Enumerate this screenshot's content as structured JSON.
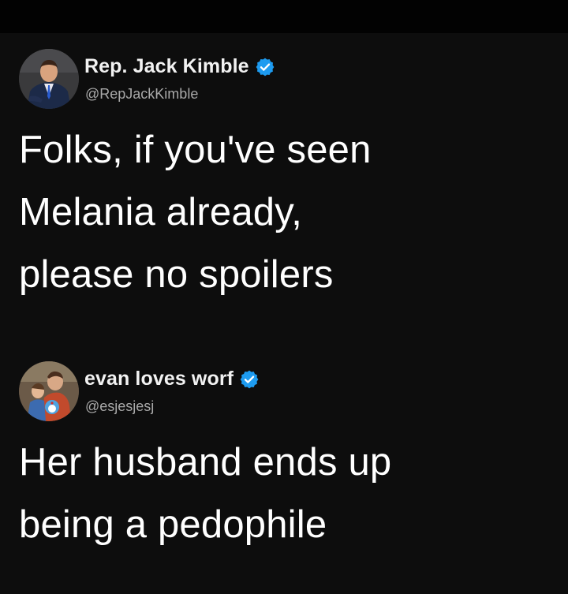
{
  "tweets": [
    {
      "display_name": "Rep. Jack Kimble",
      "handle": "@RepJackKimble",
      "verified_icon": "verified-badge-icon",
      "text_lines": [
        "Folks, if you've seen",
        "Melania already,",
        "please no spoilers"
      ]
    },
    {
      "display_name": "evan loves worf",
      "handle": "@esjesjesj",
      "verified_icon": "verified-badge-icon",
      "text_lines": [
        "Her husband ends up",
        "being a pedophile"
      ]
    }
  ],
  "colors": {
    "background": "#0d0d0d",
    "top_bar": "#020202",
    "text": "#ffffff",
    "handle": "#a9a9a9",
    "verified": "#1d9bf0"
  }
}
